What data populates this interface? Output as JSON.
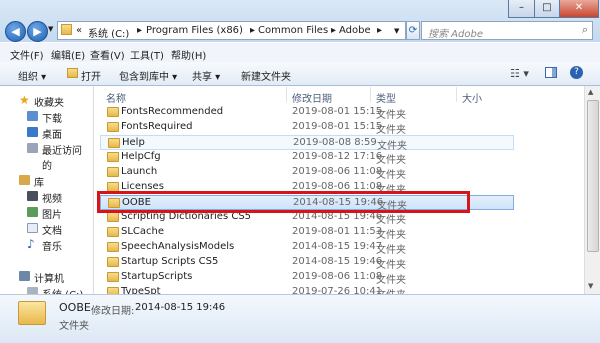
{
  "address": {
    "segments": [
      "系统 (C:)",
      "Program Files (x86)",
      "Common Files",
      "Adobe"
    ]
  },
  "search": {
    "placeholder": "搜索 Adobe"
  },
  "menu": [
    "文件(F)",
    "编辑(E)",
    "查看(V)",
    "工具(T)",
    "帮助(H)"
  ],
  "toolbar": {
    "organize": "组织 ▾",
    "open": "打开",
    "include": "包含到库中 ▾",
    "share": "共享 ▾",
    "newfolder": "新建文件夹"
  },
  "columns": {
    "name": "名称",
    "date": "修改日期",
    "type": "类型",
    "size": "大小"
  },
  "nav": {
    "favorites": "收藏夹",
    "downloads": "下载",
    "desktop": "桌面",
    "recent": "最近访问的",
    "libraries": "库",
    "videos": "视频",
    "pictures": "图片",
    "documents": "文档",
    "music": "音乐",
    "computer": "计算机",
    "systemc": "系统 (C:)"
  },
  "files": [
    {
      "name": "FontsRecommended",
      "date": "2019-08-01 15:15",
      "type": "文件夹"
    },
    {
      "name": "FontsRequired",
      "date": "2019-08-01 15:15",
      "type": "文件夹"
    },
    {
      "name": "Help",
      "date": "2019-08-08 8:59",
      "type": "文件夹"
    },
    {
      "name": "HelpCfg",
      "date": "2019-08-12 17:16",
      "type": "文件夹"
    },
    {
      "name": "Launch",
      "date": "2019-08-06 11:08",
      "type": "文件夹"
    },
    {
      "name": "Licenses",
      "date": "2019-08-06 11:08",
      "type": "文件夹"
    },
    {
      "name": "OOBE",
      "date": "2014-08-15 19:46",
      "type": "文件夹"
    },
    {
      "name": "Scripting Dictionaries CS5",
      "date": "2014-08-15 19:46",
      "type": "文件夹"
    },
    {
      "name": "SLCache",
      "date": "2019-08-01 11:53",
      "type": "文件夹"
    },
    {
      "name": "SpeechAnalysisModels",
      "date": "2014-08-15 19:47",
      "type": "文件夹"
    },
    {
      "name": "Startup Scripts CS5",
      "date": "2014-08-15 19:46",
      "type": "文件夹"
    },
    {
      "name": "StartupScripts",
      "date": "2019-08-06 11:08",
      "type": "文件夹"
    },
    {
      "name": "TypeSpt",
      "date": "2019-07-26 10:41",
      "type": "文件夹"
    }
  ],
  "details": {
    "name": "OOBE",
    "date_label": "修改日期:",
    "date": "2014-08-15 19:46",
    "type": "文件夹"
  },
  "colors": {
    "selection_border": "#84acdd",
    "highlight_box": "#d7141a",
    "folder": "#e8b84c"
  }
}
